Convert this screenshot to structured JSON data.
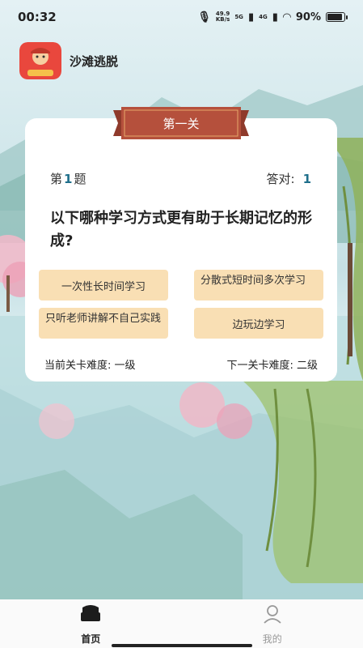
{
  "status_bar": {
    "time": "00:32",
    "speed_value": "49.9",
    "speed_unit": "KB/s",
    "net1": "5G",
    "net2": "4G",
    "battery": "90%"
  },
  "header": {
    "app_name": "沙滩逃脱"
  },
  "level": {
    "title": "第一关"
  },
  "quiz": {
    "question_prefix": "第",
    "question_number": "1",
    "question_suffix": "题",
    "correct_label": "答对:",
    "correct_count": "1",
    "question": "以下哪种学习方式更有助于长期记忆的形成?",
    "options": [
      "一次性长时间学习",
      "分散式短时间多次学习",
      "只听老师讲解不自己实践",
      "边玩边学习"
    ],
    "current_difficulty": "当前关卡难度: 一级",
    "next_difficulty": "下一关卡难度: 二级"
  },
  "nav": {
    "items": [
      {
        "label": "首页",
        "icon": "home-icon",
        "active": true
      },
      {
        "label": "我的",
        "icon": "profile-icon",
        "active": false
      }
    ]
  },
  "colors": {
    "option_bg": "#f9dfb4",
    "banner": "#b5503c",
    "accent_number": "#1f6f8b"
  }
}
